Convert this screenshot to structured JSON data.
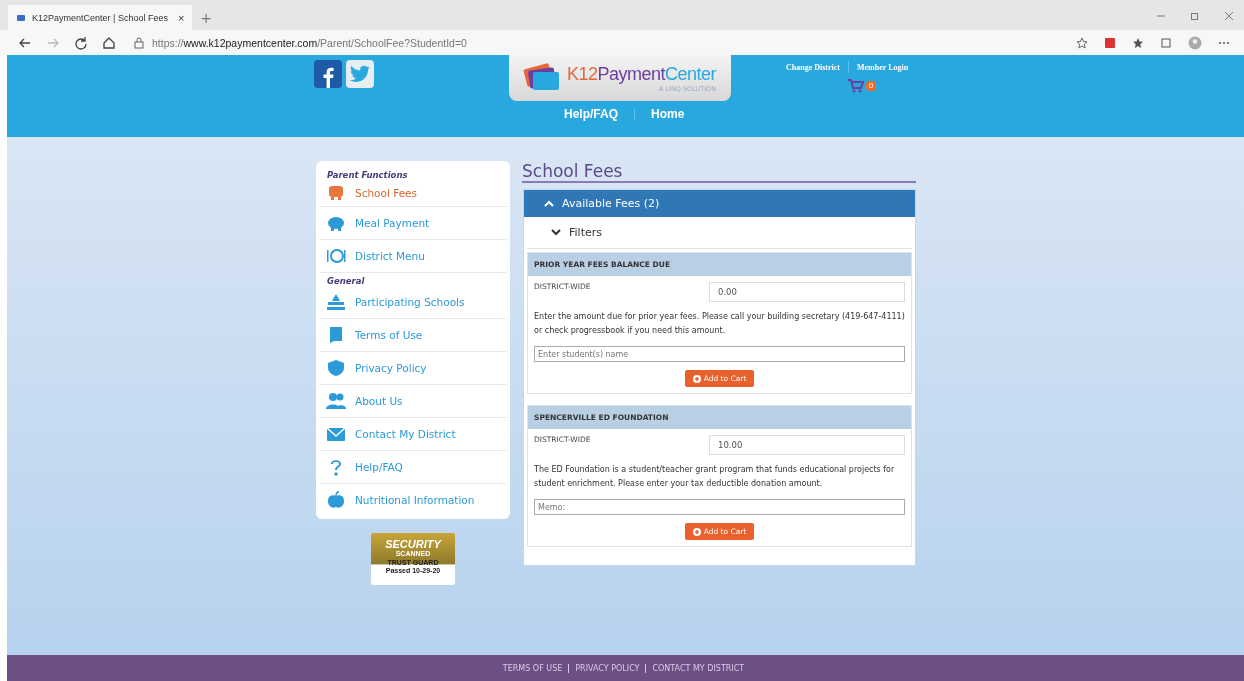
{
  "browser": {
    "tab_title": "K12PaymentCenter | School Fees",
    "tab_close": "×",
    "new_tab": "+",
    "url_prefix": "https://",
    "url_domain": "www.k12paymentcenter.com",
    "url_path": "/Parent/SchoolFee?StudentId=0"
  },
  "header": {
    "logo_text": "K12",
    "logo_text2": "Payment",
    "logo_text3": "Center",
    "logo_tagline": "A LINQ SOLUTION",
    "top_links": [
      "Change District",
      "Member Login"
    ],
    "cart_count": "0",
    "nav": [
      "Help/FAQ",
      "Home"
    ]
  },
  "sidebar": {
    "sections": [
      {
        "title": "Parent Functions",
        "items": [
          {
            "label": "School Fees",
            "kind": "bus",
            "selected": true
          },
          {
            "label": "Meal Payment",
            "kind": "piggy",
            "selected": false
          },
          {
            "label": "District Menu",
            "kind": "plate",
            "selected": false
          }
        ]
      },
      {
        "title": "General",
        "items": [
          {
            "label": "Participating Schools",
            "kind": "school",
            "selected": false
          },
          {
            "label": "Terms of Use",
            "kind": "scroll",
            "selected": false
          },
          {
            "label": "Privacy Policy",
            "kind": "shield",
            "selected": false
          },
          {
            "label": "About Us",
            "kind": "people",
            "selected": false
          },
          {
            "label": "Contact My District",
            "kind": "envelope",
            "selected": false
          },
          {
            "label": "Help/FAQ",
            "kind": "question",
            "selected": false
          },
          {
            "label": "Nutritional Information",
            "kind": "apple",
            "selected": false
          }
        ]
      }
    ],
    "badge": {
      "top": "SECURITY",
      "middle": "SCANNED",
      "bottom_left": "TRUST",
      "bottom_right": "GUARD",
      "passed": "Passed",
      "date": "10-29-20"
    }
  },
  "main": {
    "title": "School Fees",
    "panel_title": "Available Fees (2)",
    "filters": "Filters",
    "fees": [
      {
        "title": "PRIOR YEAR FEES BALANCE DUE",
        "scope": "DISTRICT-WIDE",
        "amount": "0.00",
        "description": "Enter the amount due for prior year fees. Please call your building secretary (419-647-4111) or check progressbook if you need this amount.",
        "placeholder": "Enter student(s) name",
        "button": "Add to Cart"
      },
      {
        "title": "SPENCERVILLE ED FOUNDATION",
        "scope": "DISTRICT-WIDE",
        "amount": "10.00",
        "description": "The ED Foundation is a student/teacher grant program that funds educational projects for student enrichment. Please enter your tax deductible donation amount.",
        "placeholder": "Memo:",
        "button": "Add to Cart"
      }
    ]
  },
  "footer": {
    "links": [
      "TERMS OF USE",
      "PRIVACY POLICY",
      "CONTACT MY DISTRICT"
    ]
  }
}
